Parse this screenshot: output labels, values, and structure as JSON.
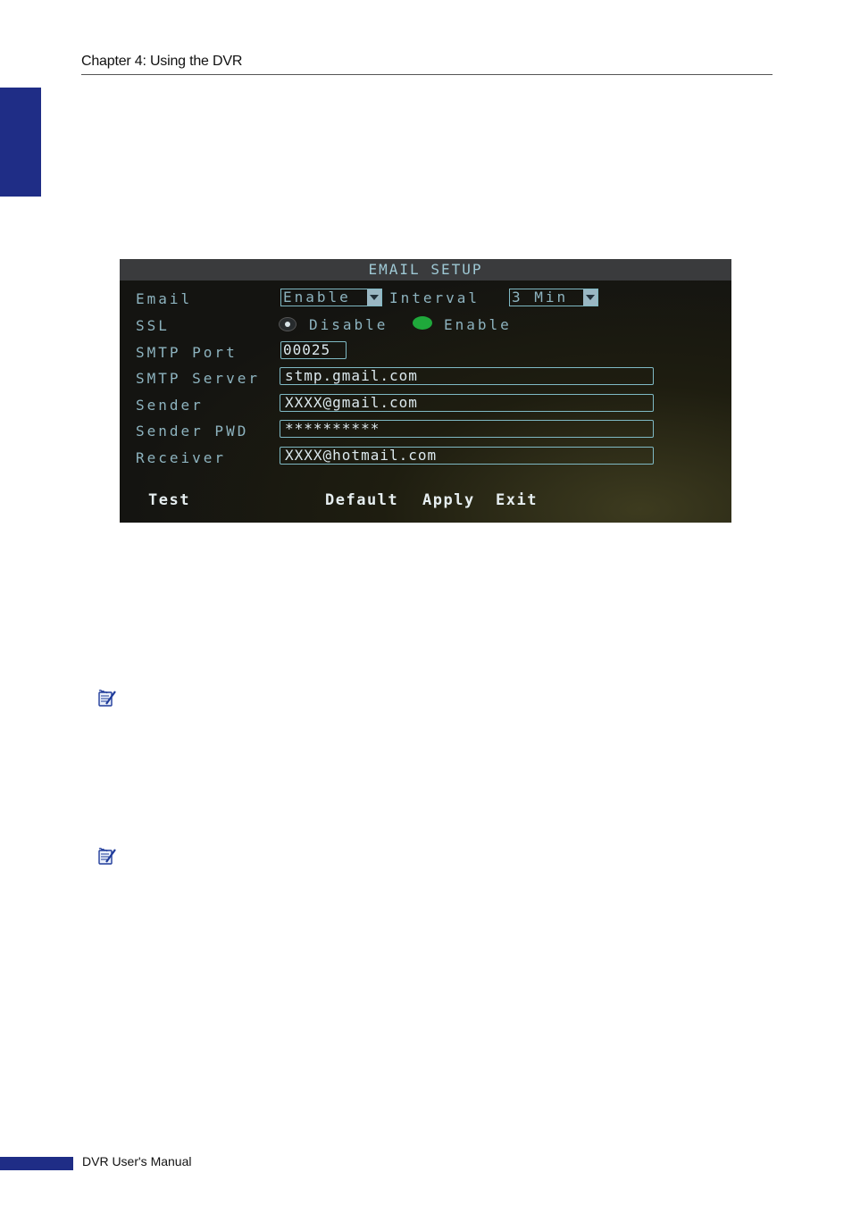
{
  "header": {
    "title": "Chapter 4: Using the DVR"
  },
  "footer": {
    "text": "DVR User's Manual"
  },
  "email_setup": {
    "title": "EMAIL SETUP",
    "labels": {
      "email": "Email",
      "ssl": "SSL",
      "smtp_port": "SMTP Port",
      "smtp_server": "SMTP Server",
      "sender": "Sender",
      "sender_pwd": "Sender PWD",
      "receiver": "Receiver"
    },
    "email_value": "Enable",
    "interval_label": "Interval",
    "interval_value": "3 Min",
    "ssl_options": [
      "Disable",
      "Enable"
    ],
    "smtp_port_value": "00025",
    "smtp_server_value": "stmp.gmail.com",
    "sender_value": "XXXX@gmail.com",
    "sender_pwd_value": "**********",
    "receiver_value": "XXXX@hotmail.com",
    "buttons": {
      "test": "Test",
      "default": "Default",
      "apply": "Apply",
      "exit": "Exit"
    }
  },
  "colors": {
    "accent_blue": "#1f2d86",
    "ssl_selected": "#1fa83b"
  },
  "icons": [
    "note-icon",
    "note-icon"
  ]
}
